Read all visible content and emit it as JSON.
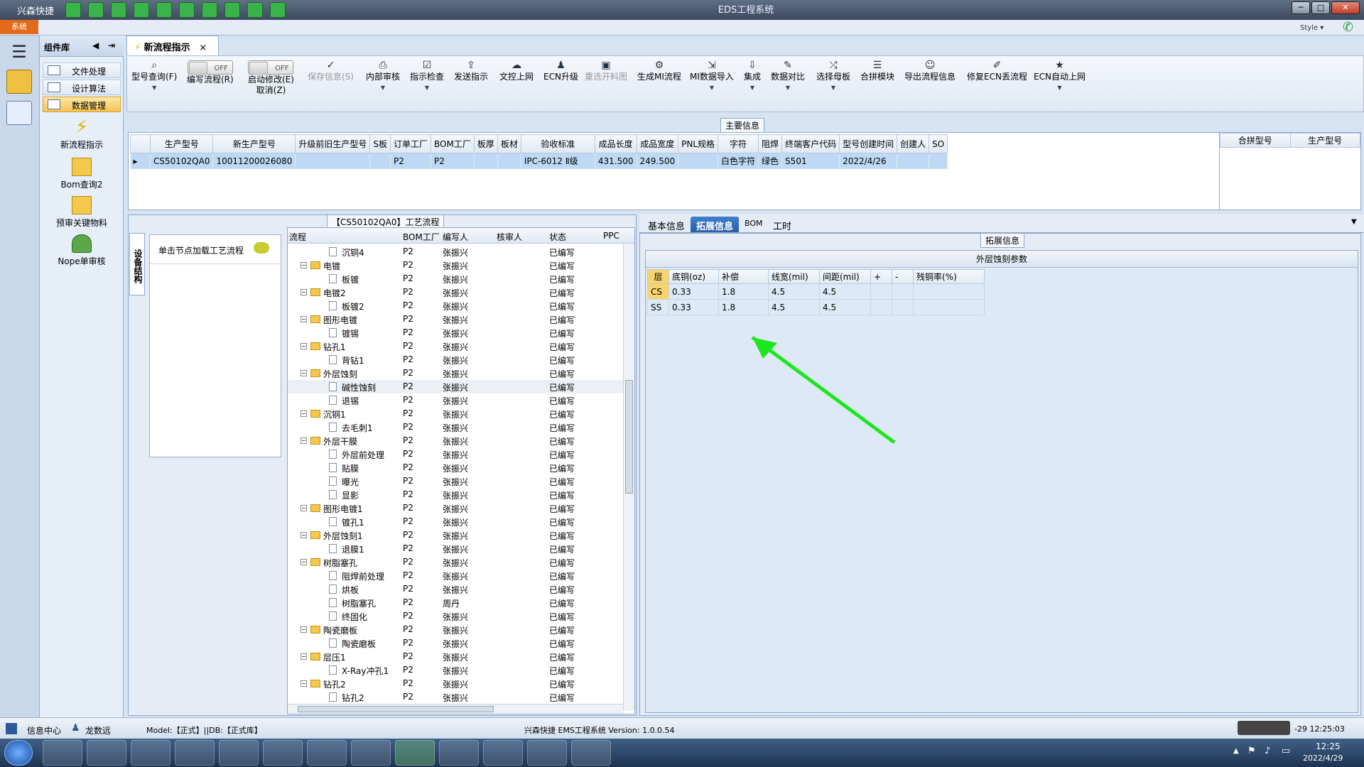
{
  "window": {
    "app_name": "兴森快捷",
    "title": "EDS工程系统",
    "system_tab": "系统",
    "style_label": "Style ▾"
  },
  "complib": {
    "title": "组件库",
    "items": [
      {
        "label": "文件处理"
      },
      {
        "label": "设计算法"
      },
      {
        "label": "数据管理"
      }
    ],
    "tiles": [
      {
        "label": "新流程指示"
      },
      {
        "label": "Bom查询2"
      },
      {
        "label": "预审关键物料"
      },
      {
        "label": "Nope单审核"
      }
    ]
  },
  "doc_tab": {
    "label": "新流程指示",
    "close": "×"
  },
  "ribbon": {
    "model_query": "型号查询(F)",
    "write_flow": "编写流程(R)",
    "enable_modify": "启动修改(E)",
    "cancel": "取消(Z)",
    "toggle_off": "OFF",
    "save_info": "保存信息(S)",
    "internal_review": "内部审核",
    "instr_check": "指示检查",
    "send_instr": "发送指示",
    "doc_upload": "文控上网",
    "ecn_upgrade": "ECN升级",
    "reselect_cut": "重选开料图",
    "gen_mi": "生成MI流程",
    "mi_import": "MI数据导入",
    "integrate": "集成",
    "data_compare": "数据对比",
    "select_mother": "选择母板",
    "merge_module": "合拼模块",
    "export_flow": "导出流程信息",
    "fix_ecn": "修复ECN丢流程",
    "ecn_auto": "ECN自动上网"
  },
  "main_info": {
    "label": "主要信息",
    "columns": [
      "生产型号",
      "新生产型号",
      "升级前旧生产型号",
      "S板",
      "订单工厂",
      "BOM工厂",
      "板厚",
      "板材",
      "验收标准",
      "成品长度",
      "成品宽度",
      "PNL规格",
      "字符",
      "阻焊",
      "终端客户代码",
      "型号创建时间",
      "创建人",
      "SO"
    ],
    "row": {
      "prod_model": "CS50102QA0",
      "new_model": "10011200026080",
      "old_model": "",
      "s_board": "",
      "order_factory": "P2",
      "bom_factory": "P2",
      "thickness": "",
      "material": "",
      "standard": "IPC-6012 Ⅱ级",
      "length": "431.500",
      "width": "249.500",
      "pnl": "",
      "char": "白色字符",
      "mask": "绿色",
      "customer": "S501",
      "created": "2022/4/26",
      "creator": "",
      "so": ""
    },
    "merge_columns": [
      "合拼型号",
      "生产型号"
    ]
  },
  "process": {
    "label": "【CS50102QA0】工艺流程",
    "side_tab": "设备结构",
    "hint": "单击节点加载工艺流程",
    "columns": [
      "流程",
      "BOM工厂",
      "编写人",
      "核审人",
      "状态",
      "PPC"
    ],
    "rows": [
      {
        "name": "沉铜4",
        "lvl": 2,
        "folder": false,
        "bom": "P2",
        "writer": "张振兴",
        "status": "已编写"
      },
      {
        "name": "电镀",
        "lvl": 1,
        "folder": true,
        "bom": "P2",
        "writer": "张振兴",
        "status": "已编写"
      },
      {
        "name": "板镀",
        "lvl": 2,
        "folder": false,
        "bom": "P2",
        "writer": "张振兴",
        "status": "已编写"
      },
      {
        "name": "电镀2",
        "lvl": 1,
        "folder": true,
        "bom": "P2",
        "writer": "张振兴",
        "status": "已编写"
      },
      {
        "name": "板镀2",
        "lvl": 2,
        "folder": false,
        "bom": "P2",
        "writer": "张振兴",
        "status": "已编写"
      },
      {
        "name": "图形电镀",
        "lvl": 1,
        "folder": true,
        "bom": "P2",
        "writer": "张振兴",
        "status": "已编写"
      },
      {
        "name": "镀锡",
        "lvl": 2,
        "folder": false,
        "bom": "P2",
        "writer": "张振兴",
        "status": "已编写"
      },
      {
        "name": "钻孔1",
        "lvl": 1,
        "folder": true,
        "bom": "P2",
        "writer": "张振兴",
        "status": "已编写"
      },
      {
        "name": "背钻1",
        "lvl": 2,
        "folder": false,
        "bom": "P2",
        "writer": "张振兴",
        "status": "已编写"
      },
      {
        "name": "外层蚀刻",
        "lvl": 1,
        "folder": true,
        "bom": "P2",
        "writer": "张振兴",
        "status": "已编写"
      },
      {
        "name": "碱性蚀刻",
        "lvl": 2,
        "folder": false,
        "bom": "P2",
        "writer": "张振兴",
        "status": "已编写",
        "hl": true
      },
      {
        "name": "退锡",
        "lvl": 2,
        "folder": false,
        "bom": "P2",
        "writer": "张振兴",
        "status": "已编写"
      },
      {
        "name": "沉铜1",
        "lvl": 1,
        "folder": true,
        "bom": "P2",
        "writer": "张振兴",
        "status": "已编写"
      },
      {
        "name": "去毛刺1",
        "lvl": 2,
        "folder": false,
        "bom": "P2",
        "writer": "张振兴",
        "status": "已编写"
      },
      {
        "name": "外层干膜",
        "lvl": 1,
        "folder": true,
        "bom": "P2",
        "writer": "张振兴",
        "status": "已编写"
      },
      {
        "name": "外层前处理",
        "lvl": 2,
        "folder": false,
        "bom": "P2",
        "writer": "张振兴",
        "status": "已编写"
      },
      {
        "name": "贴膜",
        "lvl": 2,
        "folder": false,
        "bom": "P2",
        "writer": "张振兴",
        "status": "已编写"
      },
      {
        "name": "曝光",
        "lvl": 2,
        "folder": false,
        "bom": "P2",
        "writer": "张振兴",
        "status": "已编写"
      },
      {
        "name": "显影",
        "lvl": 2,
        "folder": false,
        "bom": "P2",
        "writer": "张振兴",
        "status": "已编写"
      },
      {
        "name": "图形电镀1",
        "lvl": 1,
        "folder": true,
        "bom": "P2",
        "writer": "张振兴",
        "status": "已编写"
      },
      {
        "name": "镀孔1",
        "lvl": 2,
        "folder": false,
        "bom": "P2",
        "writer": "张振兴",
        "status": "已编写"
      },
      {
        "name": "外层蚀刻1",
        "lvl": 1,
        "folder": true,
        "bom": "P2",
        "writer": "张振兴",
        "status": "已编写"
      },
      {
        "name": "退膜1",
        "lvl": 2,
        "folder": false,
        "bom": "P2",
        "writer": "张振兴",
        "status": "已编写"
      },
      {
        "name": "树脂塞孔",
        "lvl": 1,
        "folder": true,
        "bom": "P2",
        "writer": "张振兴",
        "status": "已编写"
      },
      {
        "name": "阻焊前处理",
        "lvl": 2,
        "folder": false,
        "bom": "P2",
        "writer": "张振兴",
        "status": "已编写"
      },
      {
        "name": "烘板",
        "lvl": 2,
        "folder": false,
        "bom": "P2",
        "writer": "张振兴",
        "status": "已编写"
      },
      {
        "name": "树脂塞孔",
        "lvl": 2,
        "folder": false,
        "bom": "P2",
        "writer": "周丹",
        "status": "已编写"
      },
      {
        "name": "终固化",
        "lvl": 2,
        "folder": false,
        "bom": "P2",
        "writer": "张振兴",
        "status": "已编写"
      },
      {
        "name": "陶瓷磨板",
        "lvl": 1,
        "folder": true,
        "bom": "P2",
        "writer": "张振兴",
        "status": "已编写"
      },
      {
        "name": "陶瓷磨板",
        "lvl": 2,
        "folder": false,
        "bom": "P2",
        "writer": "张振兴",
        "status": "已编写"
      },
      {
        "name": "层压1",
        "lvl": 1,
        "folder": true,
        "bom": "P2",
        "writer": "张振兴",
        "status": "已编写"
      },
      {
        "name": "X-Ray冲孔1",
        "lvl": 2,
        "folder": false,
        "bom": "P2",
        "writer": "张振兴",
        "status": "已编写"
      },
      {
        "name": "钻孔2",
        "lvl": 1,
        "folder": true,
        "bom": "P2",
        "writer": "张振兴",
        "status": "已编写"
      },
      {
        "name": "钻孔2",
        "lvl": 2,
        "folder": false,
        "bom": "P2",
        "writer": "张振兴",
        "status": "已编写"
      }
    ]
  },
  "right": {
    "tabs": [
      "基本信息",
      "拓展信息",
      "BOM",
      "工时"
    ],
    "section_label": "拓展信息",
    "etch_title": "外层蚀刻参数",
    "etch_columns": [
      "层",
      "底铜(oz)",
      "补偿",
      "线宽(mil)",
      "间距(mil)",
      "+",
      "-",
      "残铜率(%)"
    ],
    "etch_rows": [
      [
        "CS",
        "0.33",
        "1.8",
        "4.5",
        "4.5",
        "",
        "",
        ""
      ],
      [
        "SS",
        "0.33",
        "1.8",
        "4.5",
        "4.5",
        "",
        "",
        ""
      ]
    ],
    "arrow_color": "#1ee61e"
  },
  "statusbar": {
    "info_center": "信息中心",
    "user": "龙数远",
    "model_db": "Model:【正式】||DB:【正式库】",
    "version": "兴森快捷 EMS工程系统 Version: 1.0.0.54",
    "datetime": "-29 12:25:03"
  },
  "taskbar": {
    "time": "12:25",
    "date": "2022/4/29"
  }
}
